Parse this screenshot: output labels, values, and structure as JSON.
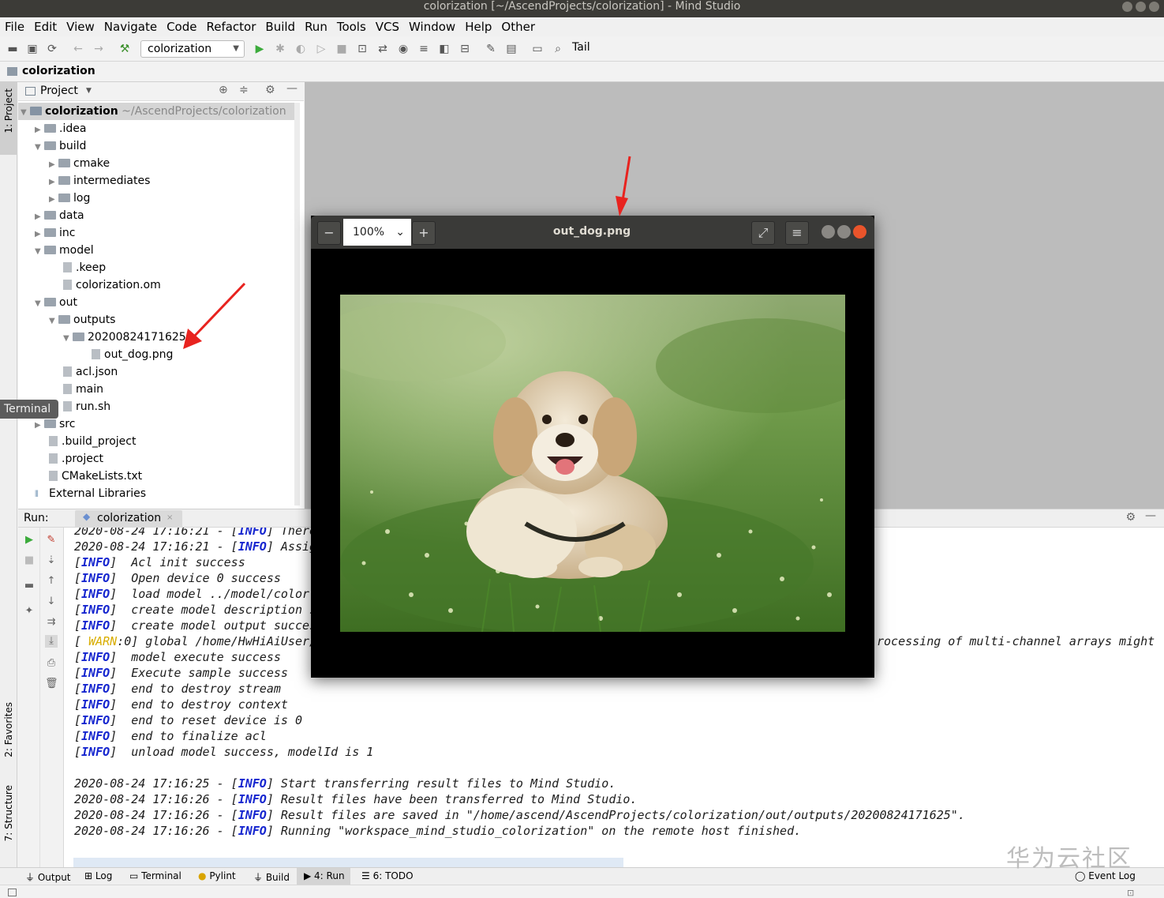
{
  "window": {
    "title": "colorization [~/AscendProjects/colorization] - Mind Studio"
  },
  "menu": [
    "File",
    "Edit",
    "View",
    "Navigate",
    "Code",
    "Refactor",
    "Build",
    "Run",
    "Tools",
    "VCS",
    "Window",
    "Help",
    "Other"
  ],
  "toolbar": {
    "run_config": "colorization",
    "tail_label": "Tail"
  },
  "breadcrumb": {
    "root": "colorization"
  },
  "side_tabs": {
    "project": "1: Project",
    "favorites": "2: Favorites",
    "structure": "7: Structure"
  },
  "project_panel": {
    "header": "Project",
    "root_name": "colorization",
    "root_path": "~/AscendProjects/colorization",
    "tree": [
      {
        "label": ".idea"
      },
      {
        "label": "build"
      },
      {
        "label": "cmake"
      },
      {
        "label": "intermediates"
      },
      {
        "label": "log"
      },
      {
        "label": "data"
      },
      {
        "label": "inc"
      },
      {
        "label": "model"
      },
      {
        "label": ".keep"
      },
      {
        "label": "colorization.om"
      },
      {
        "label": "out"
      },
      {
        "label": "outputs"
      },
      {
        "label": "20200824171625"
      },
      {
        "label": "out_dog.png"
      },
      {
        "label": "acl.json"
      },
      {
        "label": "main"
      },
      {
        "label": "run.sh"
      },
      {
        "label": "src"
      },
      {
        "label": ".build_project"
      },
      {
        "label": ".project"
      },
      {
        "label": "CMakeLists.txt"
      },
      {
        "label": "External Libraries"
      }
    ]
  },
  "terminal_tooltip": "Terminal",
  "run_panel": {
    "label": "Run:",
    "tab": "colorization",
    "lines": [
      {
        "pre": "2020-08-24 17:16:21 - [",
        "tag": "INFO",
        "post": "] There"
      },
      {
        "pre": "2020-08-24 17:16:21 - [",
        "tag": "INFO",
        "post": "] Assig"
      },
      {
        "pre": "[",
        "tag": "INFO",
        "post": "]  Acl init success"
      },
      {
        "pre": "[",
        "tag": "INFO",
        "post": "]  Open device 0 success"
      },
      {
        "pre": "[",
        "tag": "INFO",
        "post": "]  load model ../model/color"
      },
      {
        "pre": "[",
        "tag": "INFO",
        "post": "]  create model description s"
      },
      {
        "pre": "[",
        "tag": "INFO",
        "post": "]  create model output succes"
      },
      {
        "pre": "[ ",
        "tag": "WARN",
        "post": ":0] global /home/HwHiAiUser/",
        "tail": "rocessing of multi-channel arrays might"
      },
      {
        "pre": "[",
        "tag": "INFO",
        "post": "]  model execute success"
      },
      {
        "pre": "[",
        "tag": "INFO",
        "post": "]  Execute sample success"
      },
      {
        "pre": "[",
        "tag": "INFO",
        "post": "]  end to destroy stream"
      },
      {
        "pre": "[",
        "tag": "INFO",
        "post": "]  end to destroy context"
      },
      {
        "pre": "[",
        "tag": "INFO",
        "post": "]  end to reset device is 0"
      },
      {
        "pre": "[",
        "tag": "INFO",
        "post": "]  end to finalize acl"
      },
      {
        "pre": "[",
        "tag": "INFO",
        "post": "]  unload model success, modelId is 1"
      },
      {
        "pre": "",
        "tag": "",
        "post": ""
      },
      {
        "pre": "2020-08-24 17:16:25 - [",
        "tag": "INFO",
        "post": "] Start transferring result files to Mind Studio."
      },
      {
        "pre": "2020-08-24 17:16:26 - [",
        "tag": "INFO",
        "post": "] Result files have been transferred to Mind Studio."
      },
      {
        "pre": "2020-08-24 17:16:26 - [",
        "tag": "INFO",
        "post": "] Result files are saved in \"/home/ascend/AscendProjects/colorization/out/outputs/20200824171625\"."
      },
      {
        "pre": "2020-08-24 17:16:26 - [",
        "tag": "INFO",
        "post": "] Running \"workspace_mind_studio_colorization\" on the remote host finished."
      }
    ]
  },
  "bottom_tabs": [
    {
      "label": "Output"
    },
    {
      "label": "Log"
    },
    {
      "label": "Terminal"
    },
    {
      "label": "Pylint"
    },
    {
      "label": "Build"
    },
    {
      "label": "4: Run"
    },
    {
      "label": "6: TODO"
    }
  ],
  "event_log": "Event Log",
  "image_viewer": {
    "title": "out_dog.png",
    "zoom": "100%"
  },
  "watermark": "华为云社区",
  "colors": {
    "info": "#1626cf",
    "warn": "#d8ad00",
    "arrow": "#e8231f",
    "close": "#e9542b"
  }
}
